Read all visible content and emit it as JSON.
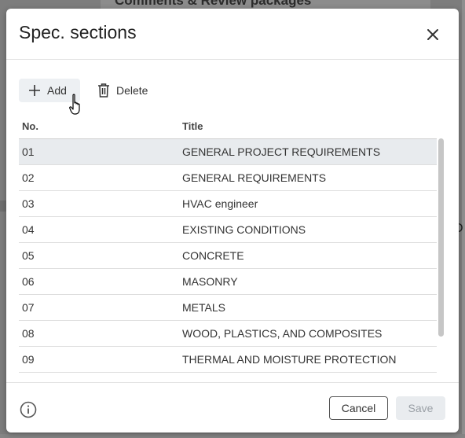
{
  "background": {
    "top_text": "Comments & Review packages",
    "right_letter": "D"
  },
  "dialog": {
    "title": "Spec. sections"
  },
  "toolbar": {
    "add_label": "Add",
    "delete_label": "Delete"
  },
  "table": {
    "columns": [
      "No.",
      "Title"
    ],
    "rows": [
      {
        "no": "01",
        "title": "GENERAL PROJECT REQUIREMENTS",
        "selected": true
      },
      {
        "no": "02",
        "title": "GENERAL REQUIREMENTS"
      },
      {
        "no": "03",
        "title": "HVAC engineer"
      },
      {
        "no": "04",
        "title": "EXISTING CONDITIONS"
      },
      {
        "no": "05",
        "title": "CONCRETE"
      },
      {
        "no": "06",
        "title": "MASONRY"
      },
      {
        "no": "07",
        "title": "METALS"
      },
      {
        "no": "08",
        "title": "WOOD, PLASTICS, AND COMPOSITES"
      },
      {
        "no": "09",
        "title": "THERMAL AND MOISTURE PROTECTION"
      }
    ]
  },
  "footer": {
    "cancel_label": "Cancel",
    "save_label": "Save"
  },
  "icons": {
    "add": "plus-icon",
    "delete": "trash-icon",
    "close": "close-icon",
    "info": "info-icon",
    "cursor": "hand-pointer-icon"
  },
  "colors": {
    "selected_row": "#e8ebee",
    "add_button_bg": "#edf0f3",
    "save_disabled_text": "#9aa0a6"
  }
}
